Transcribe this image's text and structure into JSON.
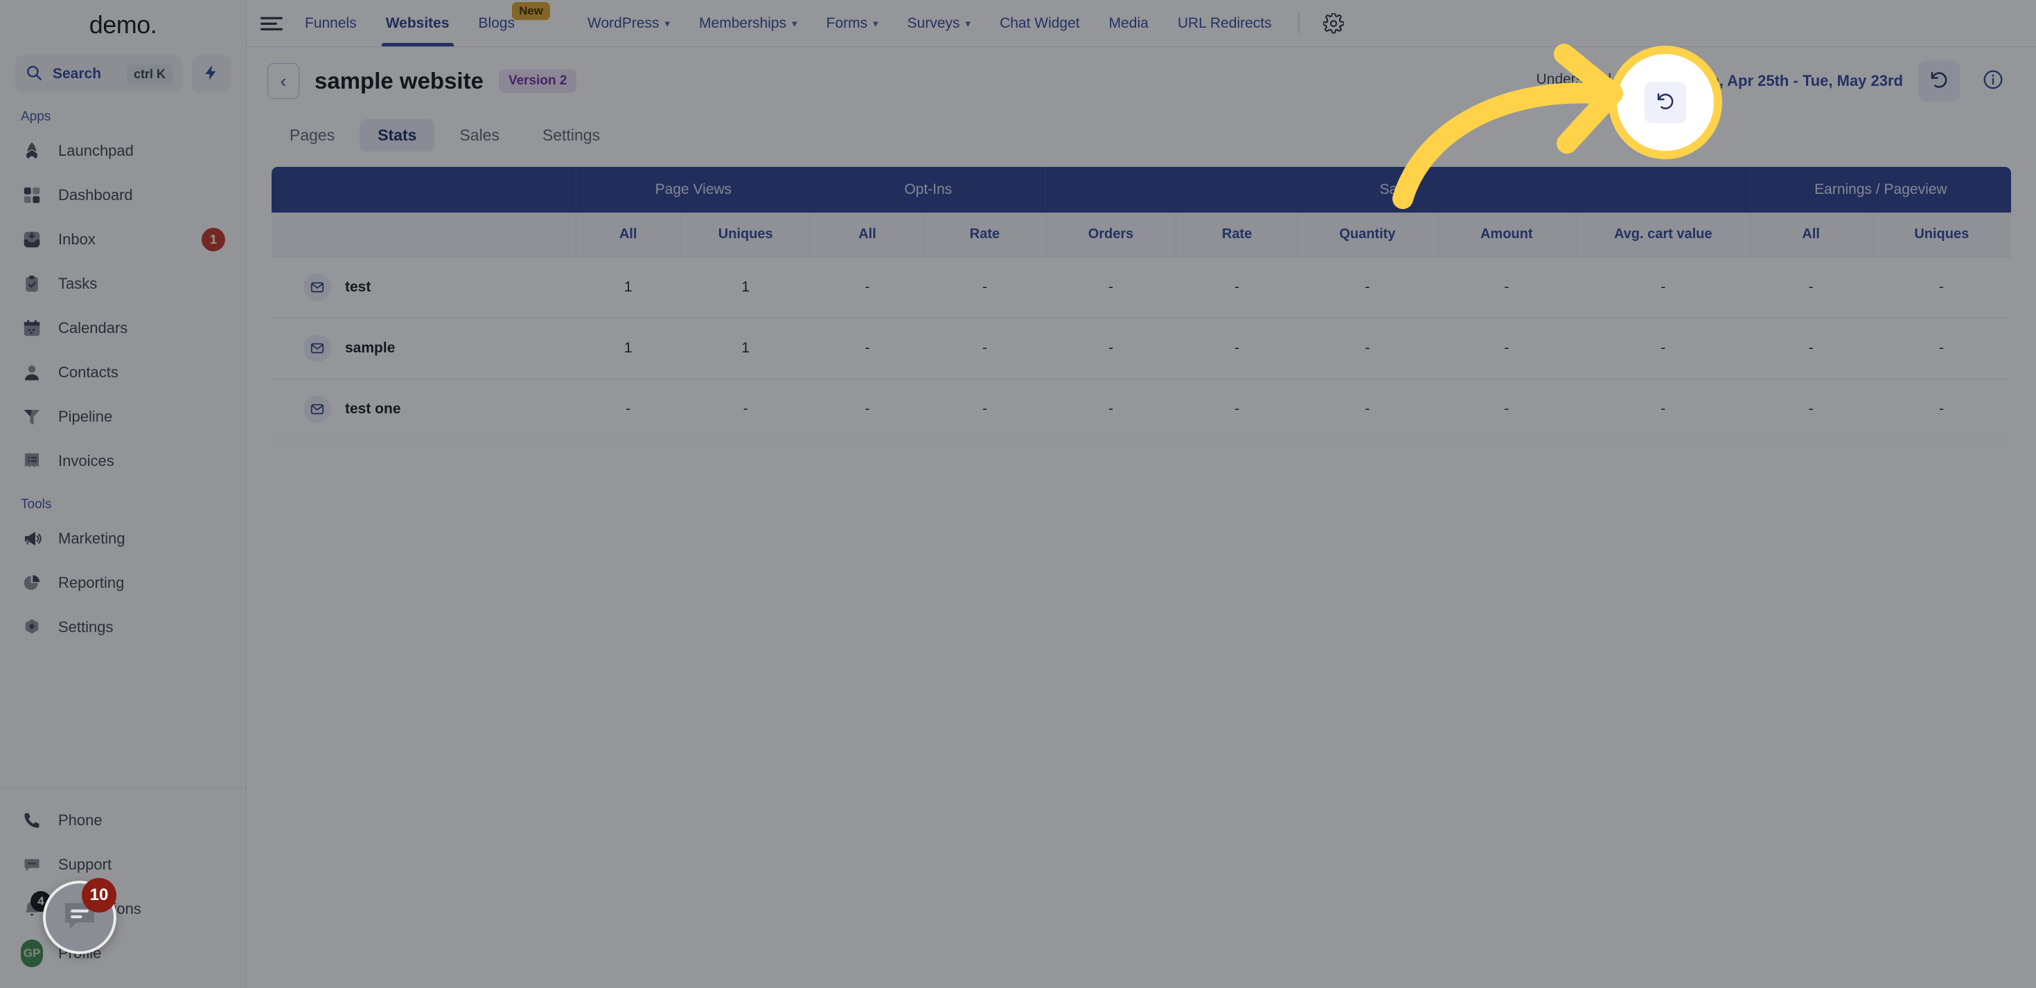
{
  "brand": {
    "name": "demo",
    "dot": "."
  },
  "sidebar": {
    "search": {
      "label": "Search",
      "shortcut": "ctrl K",
      "icon": "search-icon"
    },
    "quick_action_icon": "lightning-bolt-icon",
    "sections": [
      {
        "label": "Apps",
        "items": [
          {
            "label": "Launchpad",
            "icon": "rocket-icon"
          },
          {
            "label": "Dashboard",
            "icon": "grid-icon"
          },
          {
            "label": "Inbox",
            "icon": "inbox-icon",
            "badge": "1"
          },
          {
            "label": "Tasks",
            "icon": "clipboard-check-icon"
          },
          {
            "label": "Calendars",
            "icon": "calendar-icon"
          },
          {
            "label": "Contacts",
            "icon": "person-icon"
          },
          {
            "label": "Pipeline",
            "icon": "funnel-icon"
          },
          {
            "label": "Invoices",
            "icon": "invoice-icon"
          }
        ]
      },
      {
        "label": "Tools",
        "items": [
          {
            "label": "Marketing",
            "icon": "megaphone-icon"
          },
          {
            "label": "Reporting",
            "icon": "pie-chart-icon"
          },
          {
            "label": "Settings",
            "icon": "gear-hex-icon"
          }
        ]
      }
    ],
    "bottom_items": [
      {
        "label": "Phone",
        "icon": "phone-icon"
      },
      {
        "label": "Support",
        "icon": "chat-dots-icon"
      },
      {
        "label": "Notifications",
        "icon": "bell-icon",
        "badge": "4"
      },
      {
        "label": "Profile",
        "icon": "avatar-icon",
        "avatar_initials": "GP"
      }
    ]
  },
  "topnav": {
    "menu_icon": "hamburger-icon",
    "items": [
      {
        "label": "Funnels",
        "dropdown": false,
        "active": false
      },
      {
        "label": "Websites",
        "dropdown": false,
        "active": true
      },
      {
        "label": "Blogs",
        "dropdown": false,
        "active": false,
        "badge": "New"
      },
      {
        "label": "WordPress",
        "dropdown": true,
        "active": false
      },
      {
        "label": "Memberships",
        "dropdown": true,
        "active": false
      },
      {
        "label": "Forms",
        "dropdown": true,
        "active": false
      },
      {
        "label": "Surveys",
        "dropdown": true,
        "active": false
      },
      {
        "label": "Chat Widget",
        "dropdown": false,
        "active": false
      },
      {
        "label": "Media",
        "dropdown": false,
        "active": false
      },
      {
        "label": "URL Redirects",
        "dropdown": false,
        "active": false
      }
    ],
    "settings_icon": "gear-icon"
  },
  "header": {
    "back_icon": "chevron-left-icon",
    "title": "sample website",
    "version_badge": "Version 2",
    "understand_stats": "Understand stats",
    "calendar_icon": "calendar-icon",
    "date_range": "Tue, Apr 25th - Tue, May 23rd",
    "refresh_icon": "refresh-counterclockwise-icon",
    "info_icon": "info-circle-icon"
  },
  "subtabs": [
    {
      "label": "Pages",
      "active": false
    },
    {
      "label": "Stats",
      "active": true
    },
    {
      "label": "Sales",
      "active": false
    },
    {
      "label": "Settings",
      "active": false
    }
  ],
  "table": {
    "groups": [
      {
        "label": "",
        "span": 1
      },
      {
        "label": "Page Views",
        "span": 2
      },
      {
        "label": "Opt-Ins",
        "span": 2
      },
      {
        "label": "Sales",
        "span": 5
      },
      {
        "label": "Earnings / Pageview",
        "span": 2
      }
    ],
    "columns": [
      "",
      "All",
      "Uniques",
      "All",
      "Rate",
      "Orders",
      "Rate",
      "Quantity",
      "Amount",
      "Avg. cart value",
      "All",
      "Uniques"
    ],
    "rows": [
      {
        "icon": "mail-icon",
        "name": "test",
        "values": [
          "1",
          "1",
          "-",
          "-",
          "-",
          "-",
          "-",
          "-",
          "-",
          "-",
          "-"
        ]
      },
      {
        "icon": "mail-icon",
        "name": "sample",
        "values": [
          "1",
          "1",
          "-",
          "-",
          "-",
          "-",
          "-",
          "-",
          "-",
          "-",
          "-"
        ]
      },
      {
        "icon": "mail-icon",
        "name": "test one",
        "values": [
          "-",
          "-",
          "-",
          "-",
          "-",
          "-",
          "-",
          "-",
          "-",
          "-",
          "-"
        ]
      }
    ]
  },
  "annotation": {
    "arrow_color": "#ffd24a",
    "highlight_target": "refresh-button",
    "spotlight_ring_color": "#ffd24a"
  },
  "chat_widget": {
    "icon": "chat-icon",
    "unread": "10"
  },
  "colors": {
    "table_header": "#2d4391",
    "accent_blue": "#2f49a0",
    "badge_new": "#e0a82e",
    "version_badge_bg": "#ede3f6",
    "version_badge_text": "#6c2fa8",
    "notification_red": "#c0392b"
  }
}
